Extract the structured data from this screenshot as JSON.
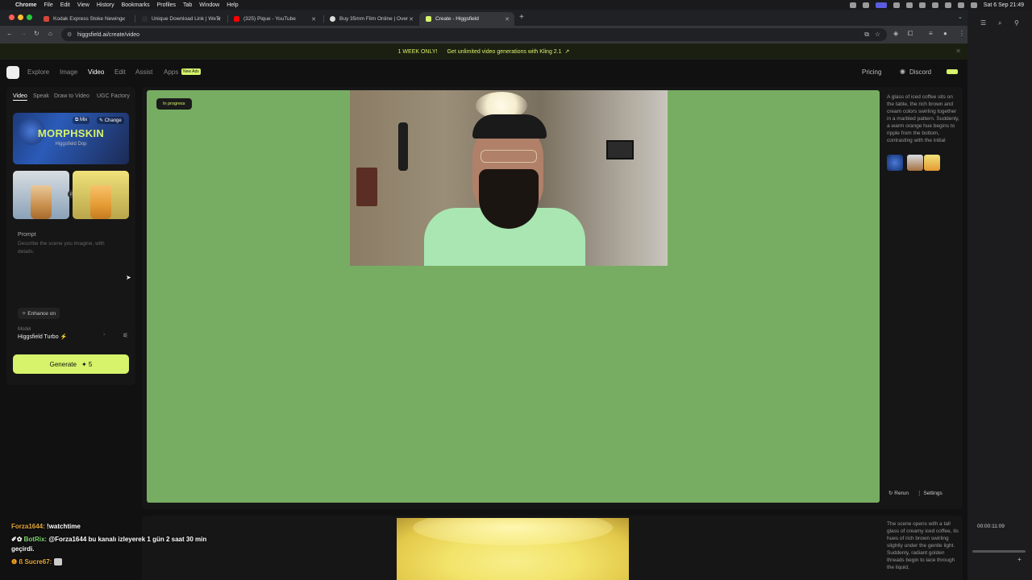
{
  "menubar": {
    "app": "Chrome",
    "items": [
      "File",
      "Edit",
      "View",
      "History",
      "Bookmarks",
      "Profiles",
      "Tab",
      "Window",
      "Help"
    ],
    "clock": "Sat 6 Sep  21:49"
  },
  "tabs": [
    {
      "title": "Kodak Express Stoke Newing",
      "favicon_color": "#d44638"
    },
    {
      "title": "Unique Download Link | WeTr",
      "favicon_color": "#2c2c2c"
    },
    {
      "title": "(325) Pique - YouTube",
      "favicon_color": "#ff0000"
    },
    {
      "title": "Buy 35mm Film Online | Over",
      "favicon_color": "#dddddd"
    },
    {
      "title": "Create - Higgsfield",
      "favicon_color": "#d6f36b"
    }
  ],
  "address": {
    "url": "higgsfield.ai/create/video"
  },
  "banner": {
    "tag": "1 WEEK ONLY!",
    "text": "Get unlimited video generations with Kling 2.1",
    "arrow": "↗"
  },
  "nav": {
    "items": [
      "Explore",
      "Image",
      "Video",
      "Edit",
      "Assist",
      "Apps"
    ],
    "active": "Video",
    "new_badge": "New Ads",
    "pricing": "Pricing",
    "discord": "Discord"
  },
  "left": {
    "tabs": [
      "Video",
      "Speak",
      "Draw to Video",
      "UGC Factory"
    ],
    "preset": {
      "title": "MORPHSKIN",
      "subtitle": "Higgsfield Dop",
      "mix": "Mix",
      "change": "Change"
    },
    "prompt_label": "Prompt",
    "prompt_placeholder": "Describe the scene you imagine, with details.",
    "enhance": "Enhance on",
    "model_label": "Model",
    "model_value": "Higgsfield Turbo ⚡",
    "generate_label": "Generate",
    "generate_cost": "✦ 5"
  },
  "card1": {
    "status": "In progress",
    "description": "A glass of iced coffee sits on the table, the rich brown and cream colors swirling together in a marbled pattern. Suddenly, a warm orange hue begins to ripple from the bottom, contrasting with the initial",
    "rerun": "Rerun",
    "settings": "Settings"
  },
  "card2": {
    "description": "The scene opens with a tall glass of creamy iced coffee, its hues of rich brown swirling slightly under the gentle light. Suddenly, radiant golden threads begin to lace through the liquid,"
  },
  "chat": [
    {
      "user": "Forza1644:",
      "msg": "!watchtime"
    },
    {
      "user": "BotRix:",
      "msg": "@Forza1644 bu kanalı izleyerek 1 gün 2 saat 30 min geçirdi."
    },
    {
      "user": "Sucre67:",
      "msg": ""
    }
  ],
  "overlay": {
    "timer": "00:00:11:09"
  }
}
